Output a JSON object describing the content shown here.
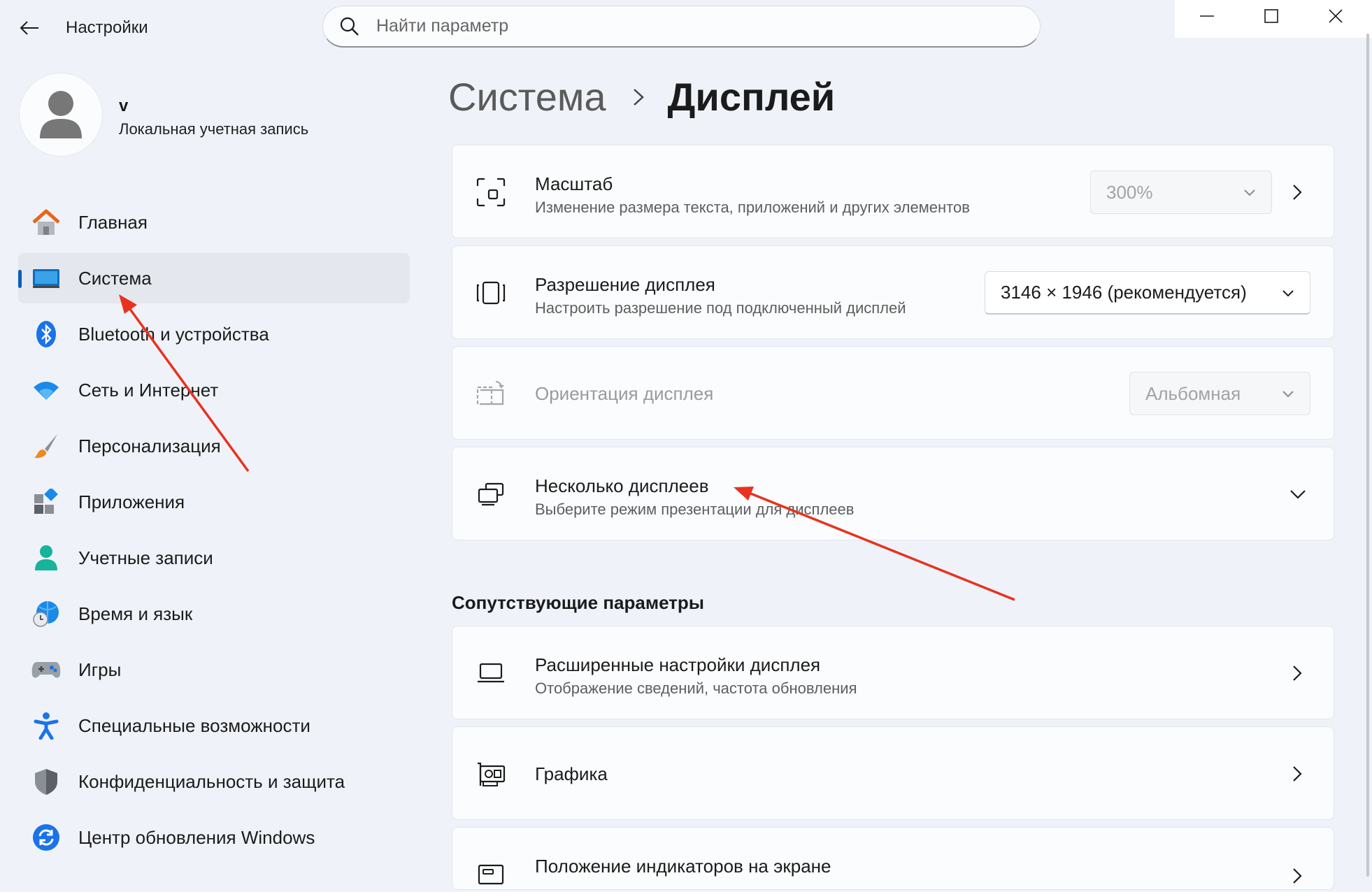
{
  "app": {
    "title": "Настройки"
  },
  "search": {
    "placeholder": "Найти параметр"
  },
  "account": {
    "name": "v",
    "type": "Локальная учетная запись"
  },
  "sidebar": {
    "items": [
      {
        "label": "Главная",
        "icon": "home-icon"
      },
      {
        "label": "Система",
        "icon": "system-display-icon",
        "active": true
      },
      {
        "label": "Bluetooth и устройства",
        "icon": "bluetooth-icon"
      },
      {
        "label": "Сеть и Интернет",
        "icon": "wifi-icon"
      },
      {
        "label": "Персонализация",
        "icon": "brush-icon"
      },
      {
        "label": "Приложения",
        "icon": "apps-icon"
      },
      {
        "label": "Учетные записи",
        "icon": "person-icon"
      },
      {
        "label": "Время и язык",
        "icon": "globe-clock-icon"
      },
      {
        "label": "Игры",
        "icon": "gamepad-icon"
      },
      {
        "label": "Специальные возможности",
        "icon": "accessibility-icon"
      },
      {
        "label": "Конфиденциальность и защита",
        "icon": "shield-icon"
      },
      {
        "label": "Центр обновления Windows",
        "icon": "update-icon"
      }
    ]
  },
  "breadcrumb": {
    "parent": "Система",
    "current": "Дисплей"
  },
  "cards": {
    "scale": {
      "title": "Масштаб",
      "subtitle": "Изменение размера текста, приложений и других элементов",
      "value": "300%"
    },
    "resolution": {
      "title": "Разрешение дисплея",
      "subtitle": "Настроить разрешение под подключенный дисплей",
      "value": "3146 × 1946 (рекомендуется)"
    },
    "orientation": {
      "title": "Ориентация дисплея",
      "value": "Альбомная"
    },
    "multiple": {
      "title": "Несколько дисплеев",
      "subtitle": "Выберите режим презентации для дисплеев"
    }
  },
  "related": {
    "title": "Сопутствующие параметры",
    "advanced": {
      "title": "Расширенные настройки дисплея",
      "subtitle": "Отображение сведений, частота обновления"
    },
    "graphics": {
      "title": "Графика"
    },
    "indicators": {
      "title": "Положение индикаторов на экране"
    }
  },
  "annotations": {
    "arrow_color": "#e8321f"
  },
  "colors": {
    "accent": "#0a5cc4",
    "background": "#eff3f9",
    "card": "#fbfcfd"
  }
}
